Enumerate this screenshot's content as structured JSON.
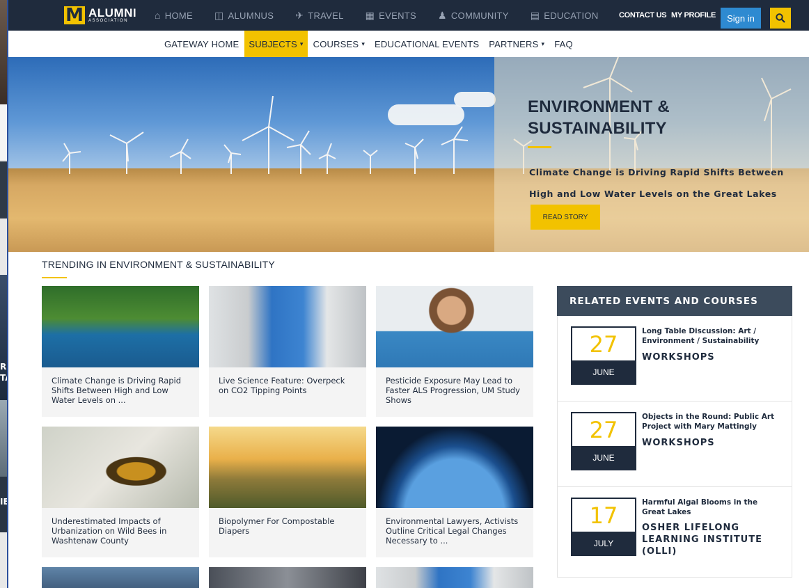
{
  "background_window": {
    "label_1": "R",
    "label_2": "TA",
    "label_3": "IE"
  },
  "topbar": {
    "logo": {
      "mark": "M",
      "name": "ALUMNI",
      "sub": "ASSOCIATION"
    },
    "nav": [
      {
        "label": "HOME",
        "icon": "home-icon"
      },
      {
        "label": "ALUMNUS",
        "icon": "book-icon"
      },
      {
        "label": "TRAVEL",
        "icon": "plane-icon"
      },
      {
        "label": "EVENTS",
        "icon": "calendar-icon"
      },
      {
        "label": "COMMUNITY",
        "icon": "people-icon"
      },
      {
        "label": "EDUCATION",
        "icon": "building-icon"
      }
    ],
    "contact_us": "CONTACT US",
    "my_profile": "MY PROFILE",
    "sign_in": "Sign in",
    "search_icon": "search-icon"
  },
  "subnav": [
    {
      "label": "GATEWAY HOME",
      "caret": ""
    },
    {
      "label": "SUBJECTS",
      "caret": "▾"
    },
    {
      "label": "COURSES",
      "caret": "▾"
    },
    {
      "label": "EDUCATIONAL EVENTS",
      "caret": ""
    },
    {
      "label": "PARTNERS",
      "caret": "▾"
    },
    {
      "label": "FAQ",
      "caret": ""
    }
  ],
  "hero": {
    "title": "ENVIRONMENT & SUSTAINABILITY",
    "subtitle": "Climate Change is Driving Rapid Shifts Between High and Low Water Levels on the Great Lakes",
    "button": "READ STORY"
  },
  "trending": {
    "title": "TRENDING IN ENVIRONMENT & SUSTAINABILITY",
    "cards": [
      {
        "text": "Climate Change is Driving Rapid Shifts Between High and Low Water Levels on ..."
      },
      {
        "text": "Live Science Feature: Overpeck on CO2 Tipping Points"
      },
      {
        "text": "Pesticide Exposure May Lead to Faster ALS Progression, UM Study Shows"
      },
      {
        "text": "Underestimated Impacts of Urbanization on Wild Bees in Washtenaw County"
      },
      {
        "text": "Biopolymer For Compostable Diapers"
      },
      {
        "text": "Environmental Lawyers, Activists Outline Critical Legal Changes Necessary to ..."
      }
    ]
  },
  "events": {
    "title": "RELATED EVENTS AND COURSES",
    "items": [
      {
        "day": "27",
        "month": "JUNE",
        "title": "Long Table Discussion: Art / Environment / Sustainability",
        "category": "WORKSHOPS"
      },
      {
        "day": "27",
        "month": "JUNE",
        "title": "Objects in the Round: Public Art Project with Mary Mattingly",
        "category": "WORKSHOPS"
      },
      {
        "day": "17",
        "month": "JULY",
        "title": "Harmful Algal Blooms in the Great Lakes",
        "category": "OSHER LIFELONG LEARNING INSTITUTE (OLLI)"
      }
    ]
  },
  "colors": {
    "navy": "#1f2b3d",
    "maize": "#f2c200",
    "blue": "#2e8ad1",
    "slate": "#3c4b5c"
  }
}
